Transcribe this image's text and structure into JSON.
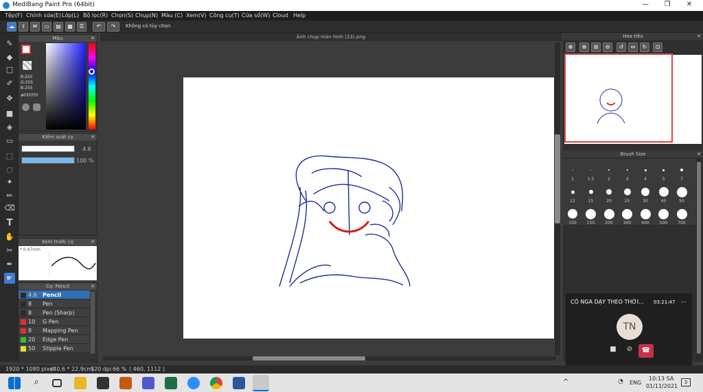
{
  "window": {
    "title": "MediBang Paint Pro (64bit)",
    "min": "—",
    "max": "❐",
    "close": "✕"
  },
  "menu": [
    "Tệp(F)",
    "Chỉnh sửa(E)",
    "Lớp(L)",
    "Bộ lọc(R)",
    "Chọn(S)",
    "Chụp(N)",
    "Màu (C)",
    "Xem(V)",
    "Công cụ(T)",
    "Cửa sổ(W)",
    "Cloud",
    "Help"
  ],
  "toolbar": {
    "selection_hint": "Không có tùy chọn"
  },
  "color_panel": {
    "title": "Màu",
    "r": "R:255",
    "g": "G:255",
    "b": "B:255",
    "hex": "#FFFFFF"
  },
  "brush_control": {
    "title": "Kiểm soát cọ",
    "size": "4.6",
    "opacity": "100 %",
    "opacity_fill": 1.0
  },
  "preview": {
    "title": "Xem trước cọ",
    "size": "* 0.97mm"
  },
  "brush_list": {
    "title": "Cọ: Pencil",
    "items": [
      {
        "size": "4.6",
        "name": "Pencil",
        "color": "#2b2b2b"
      },
      {
        "size": "8",
        "name": "Pen",
        "color": "#2b2b2b"
      },
      {
        "size": "8",
        "name": "Pen (Sharp)",
        "color": "#2b2b2b"
      },
      {
        "size": "10",
        "name": "G Pen",
        "color": "#e03030"
      },
      {
        "size": "8",
        "name": "Mapping Pen",
        "color": "#e03030"
      },
      {
        "size": "20",
        "name": "Edge Pen",
        "color": "#30c030"
      },
      {
        "size": "50",
        "name": "Stipple Pen",
        "color": "#e0e030"
      }
    ]
  },
  "document": {
    "tab": "Ảnh chụp màn hình (23).png"
  },
  "navigator": {
    "title": "Hoa tiêu"
  },
  "brush_size": {
    "title": "Brush Size",
    "row1": [
      "1",
      "1.5",
      "2",
      "3",
      "4",
      "5",
      "7"
    ],
    "row2": [
      "12",
      "15",
      "20",
      "25",
      "30",
      "40",
      "50"
    ],
    "row3": [
      "100",
      "150",
      "200",
      "300",
      "400",
      "500",
      "700"
    ]
  },
  "call": {
    "name": "CÔ NGA DẠY THEO THỜI...",
    "timer": "03:21:47",
    "more": "...",
    "initials": "TN"
  },
  "status": {
    "dims": "1920 * 1080 pixel",
    "cm": "(40.6 * 22.9cm)",
    "dpi": "120 dpi",
    "zoom": "66 %",
    "coord": "( 460, 1112 )"
  },
  "taskbar": {
    "lang": "ENG",
    "time": "10:13 SA",
    "date": "01/11/2021",
    "notif": "3"
  }
}
